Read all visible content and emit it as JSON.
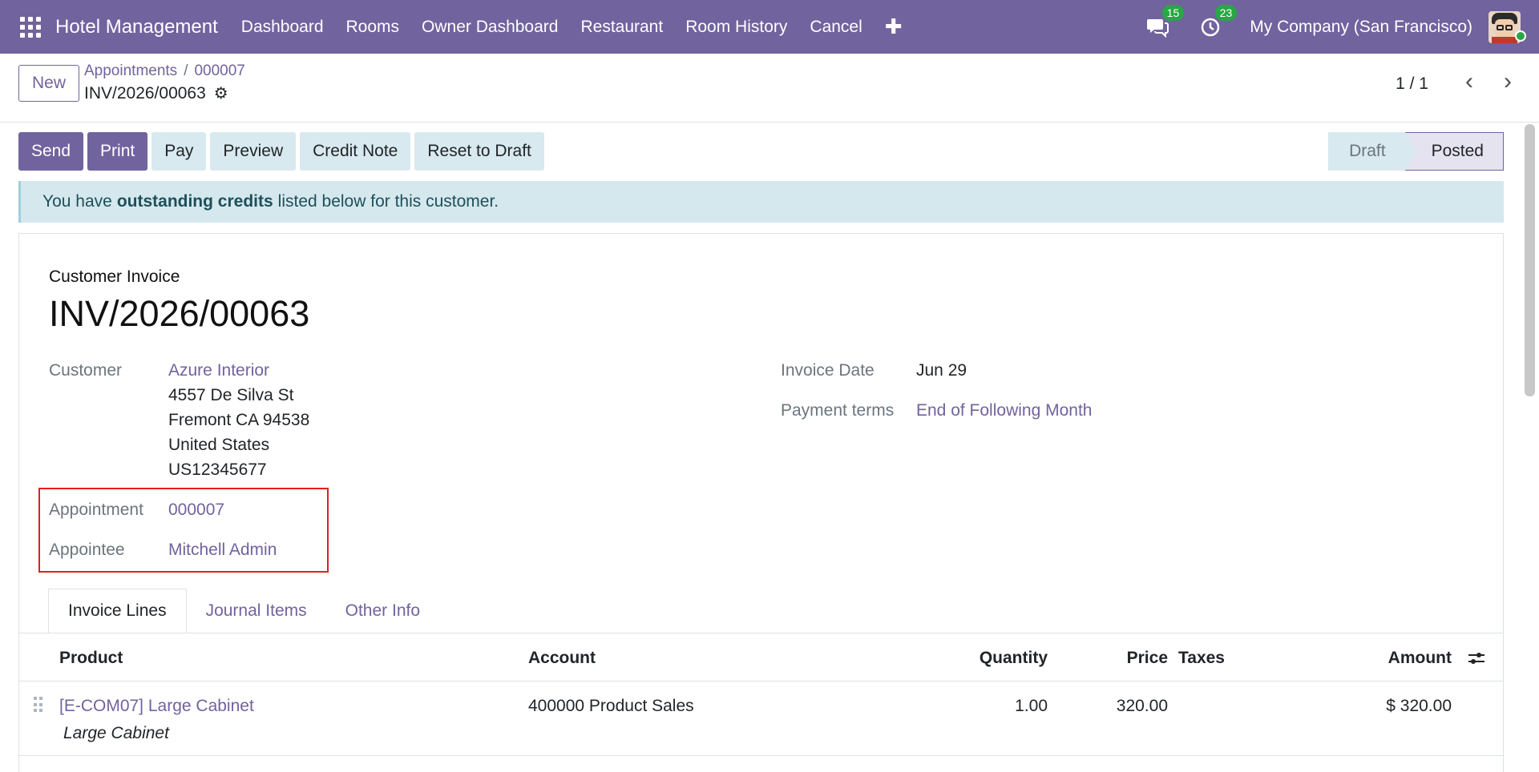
{
  "topbar": {
    "app_name": "Hotel Management",
    "menu": [
      "Dashboard",
      "Rooms",
      "Owner Dashboard",
      "Restaurant",
      "Room History",
      "Cancel"
    ],
    "plus": "✚",
    "messages_count": "15",
    "activities_count": "23",
    "company": "My Company (San Francisco)"
  },
  "control": {
    "new_label": "New",
    "breadcrumb": [
      "Appointments",
      "000007"
    ],
    "record_title": "INV/2026/00063",
    "pager": "1 / 1"
  },
  "actions": [
    "Send",
    "Print",
    "Pay",
    "Preview",
    "Credit Note",
    "Reset to Draft"
  ],
  "status": {
    "draft": "Draft",
    "posted": "Posted"
  },
  "alert": {
    "prefix": "You have",
    "bold": "outstanding credits",
    "suffix": "listed below for this customer."
  },
  "sheet": {
    "doc_type": "Customer Invoice",
    "doc_name": "INV/2026/00063",
    "customer_label": "Customer",
    "customer_name": "Azure Interior",
    "address": [
      "4557 De Silva St",
      "Fremont CA 94538",
      "United States",
      "US12345677"
    ],
    "appointment_label": "Appointment",
    "appointment_value": "000007",
    "appointee_label": "Appointee",
    "appointee_value": "Mitchell Admin",
    "invoice_date_label": "Invoice Date",
    "invoice_date": "Jun 29",
    "payment_terms_label": "Payment terms",
    "payment_terms": "End of Following Month"
  },
  "tabs": [
    "Invoice Lines",
    "Journal Items",
    "Other Info"
  ],
  "table": {
    "headers": {
      "product": "Product",
      "account": "Account",
      "quantity": "Quantity",
      "price": "Price",
      "taxes": "Taxes",
      "amount": "Amount"
    },
    "rows": [
      {
        "product": "[E-COM07] Large Cabinet",
        "description": "Large Cabinet",
        "account": "400000 Product Sales",
        "quantity": "1.00",
        "price": "320.00",
        "taxes": "",
        "amount": "$ 320.00"
      }
    ]
  }
}
